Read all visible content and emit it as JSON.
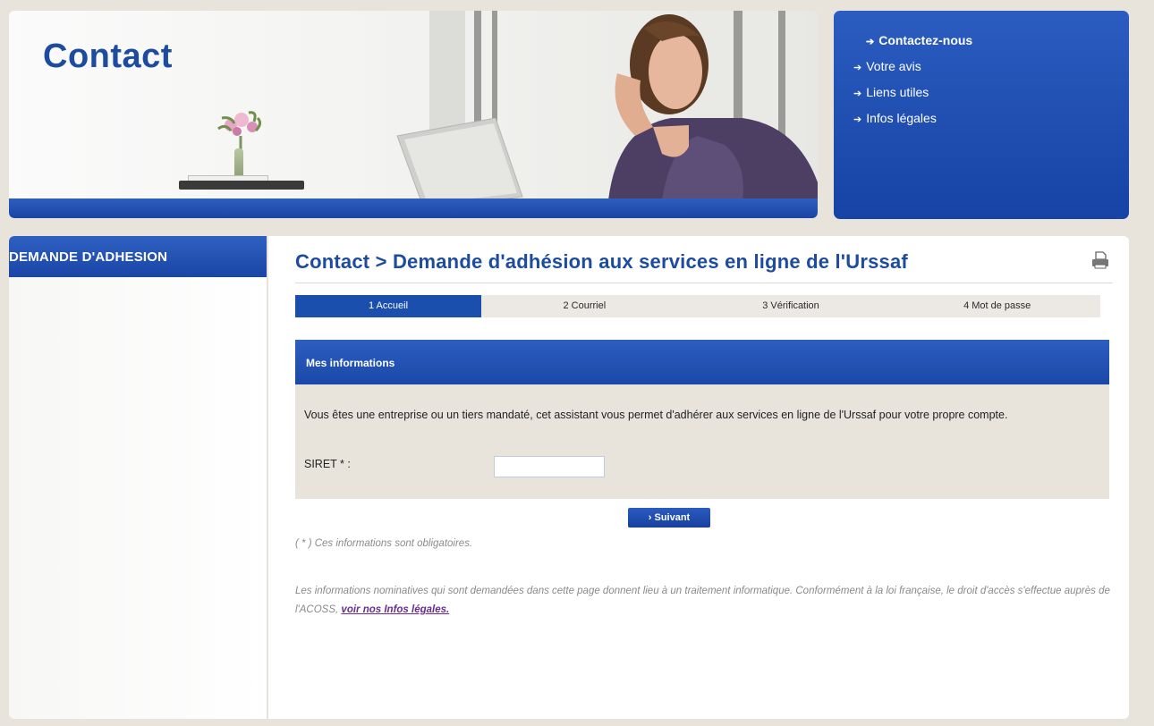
{
  "hero": {
    "title": "Contact"
  },
  "top_nav": {
    "items": [
      {
        "label": "Contactez-nous",
        "active": true
      },
      {
        "label": "Votre avis",
        "active": false
      },
      {
        "label": "Liens utiles",
        "active": false
      },
      {
        "label": "Infos légales",
        "active": false
      }
    ]
  },
  "sidebar": {
    "heading": "DEMANDE D'ADHESION"
  },
  "main": {
    "title": "Contact > Demande d'adhésion aux services en ligne de l'Urssaf",
    "print_icon": "print-icon",
    "steps": [
      {
        "label": "1 Accueil",
        "active": true
      },
      {
        "label": "2 Courriel",
        "active": false
      },
      {
        "label": "3 Vérification",
        "active": false
      },
      {
        "label": "4 Mot de passe",
        "active": false
      }
    ],
    "section": {
      "heading": "Mes informations",
      "description": "Vous êtes une entreprise ou un tiers mandaté, cet assistant vous permet d'adhérer aux services en ligne de l'Urssaf pour votre propre compte.",
      "siret_label": "SIRET * :",
      "siret_value": ""
    },
    "next_button": "› Suivant",
    "required_note": "( * ) Ces informations sont obligatoires.",
    "legal_text": "Les informations nominatives qui sont demandées dans cette page donnent lieu à un traitement informatique. Conformément à la loi française, le droit d'accès s'effectue auprès de l'ACOSS,",
    "legal_link": "voir nos Infos légales."
  },
  "colors": {
    "brand_blue": "#1a4fae",
    "title_blue": "#1d4c9e",
    "panel_beige": "#e8e4dc",
    "link_purple": "#6b2c8f"
  }
}
